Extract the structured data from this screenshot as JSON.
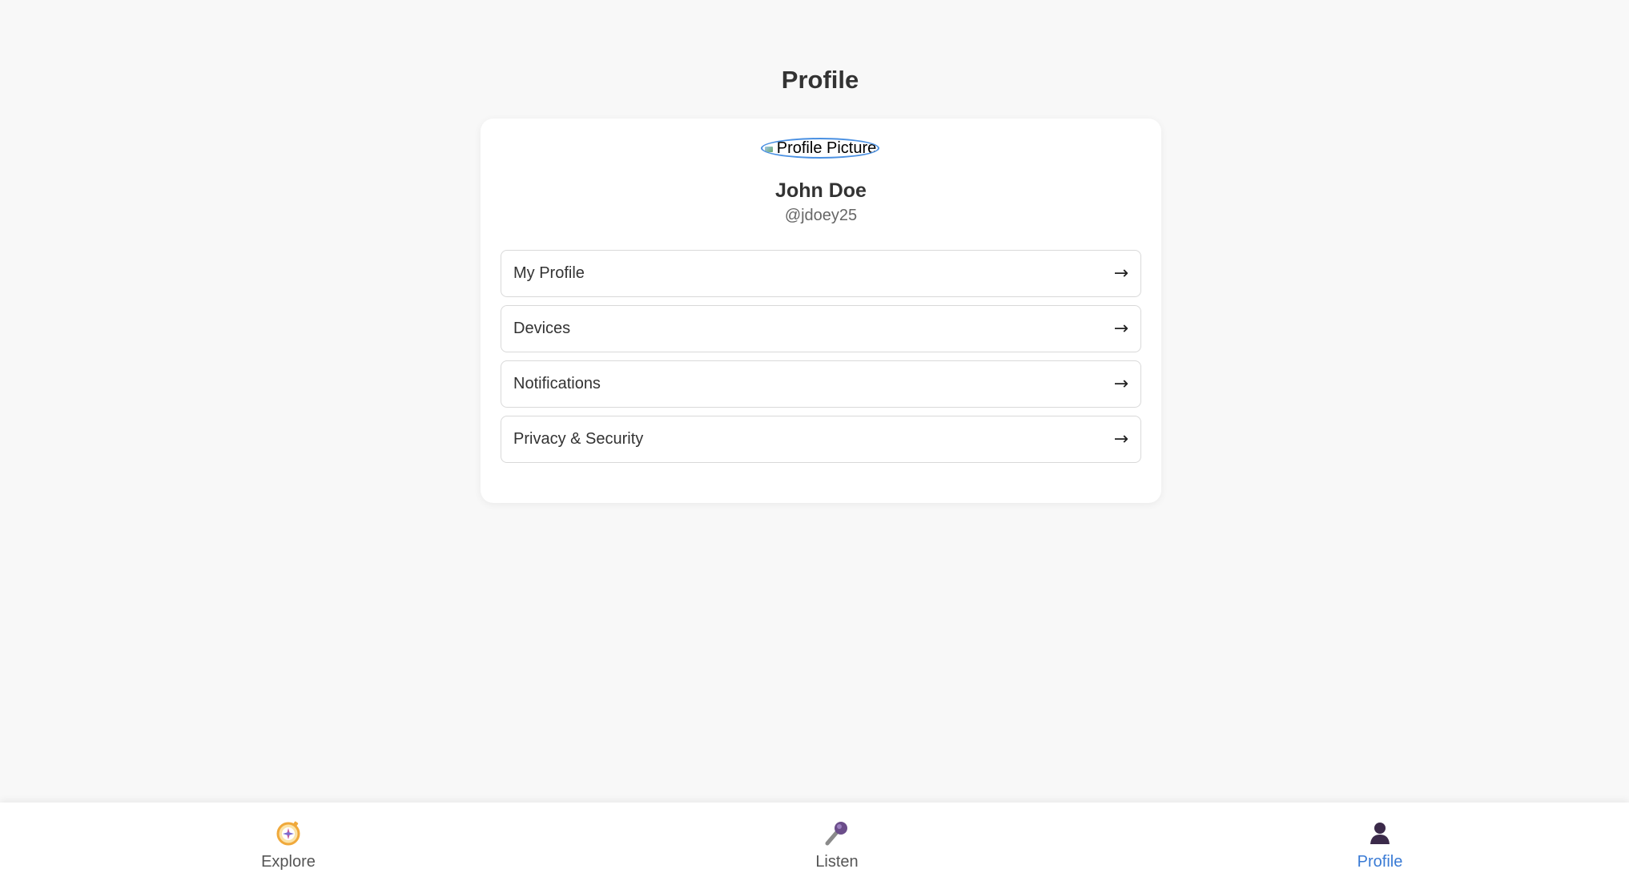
{
  "header": {
    "title": "Profile"
  },
  "profile": {
    "avatar_alt": "Profile Picture",
    "name": "John Doe",
    "handle": "@jdoey25"
  },
  "menu": {
    "items": [
      {
        "label": "My Profile",
        "icon": "arrow-right-icon"
      },
      {
        "label": "Devices",
        "icon": "arrow-right-icon"
      },
      {
        "label": "Notifications",
        "icon": "arrow-right-icon"
      },
      {
        "label": "Privacy & Security",
        "icon": "arrow-right-icon"
      }
    ]
  },
  "bottom_nav": {
    "items": [
      {
        "label": "Explore",
        "icon": "compass-icon",
        "active": false
      },
      {
        "label": "Listen",
        "icon": "microphone-icon",
        "active": false
      },
      {
        "label": "Profile",
        "icon": "person-icon",
        "active": true
      }
    ]
  },
  "colors": {
    "background": "#f8f8f8",
    "card": "#ffffff",
    "accent": "#3a7bd5",
    "avatar_border": "#4a90e2"
  }
}
